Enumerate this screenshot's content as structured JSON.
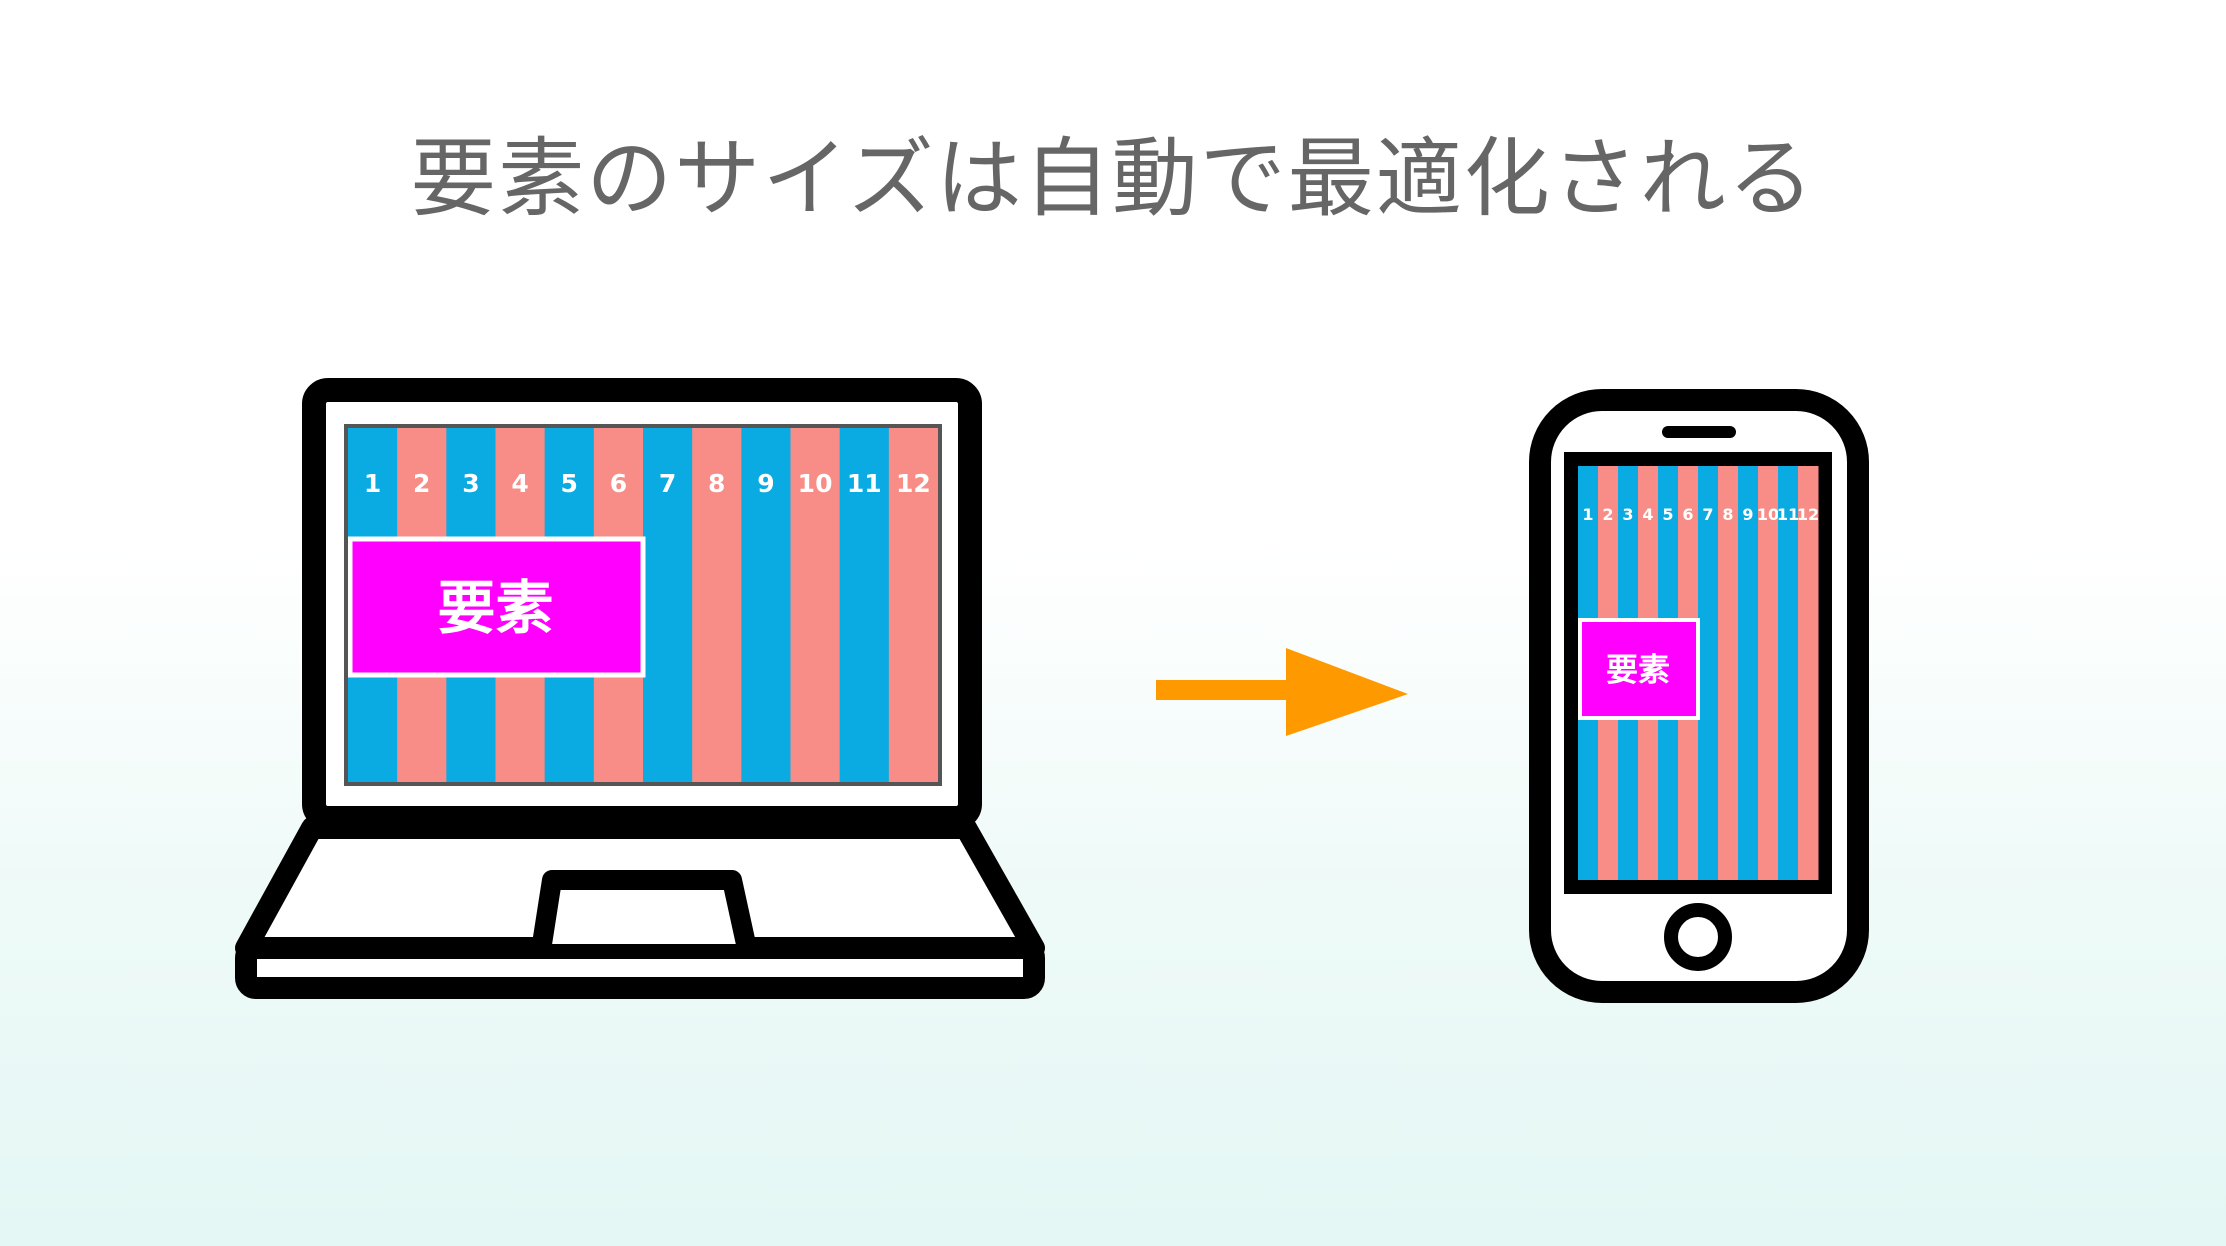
{
  "title": "要素のサイズは自動で最適化される",
  "element_label": "要素",
  "columns": [
    "1",
    "2",
    "3",
    "4",
    "5",
    "6",
    "7",
    "8",
    "9",
    "10",
    "11",
    "12"
  ],
  "laptop_element_span": 6,
  "phone_element_span": 6,
  "colors": {
    "column_blue": "#0aabe2",
    "column_pink": "#f88d87",
    "element": "#ff00ff",
    "arrow": "#ff9900",
    "device": "#000000",
    "title_text": "#666666"
  },
  "icons": [
    "laptop-icon",
    "smartphone-icon",
    "arrow-right-icon"
  ]
}
